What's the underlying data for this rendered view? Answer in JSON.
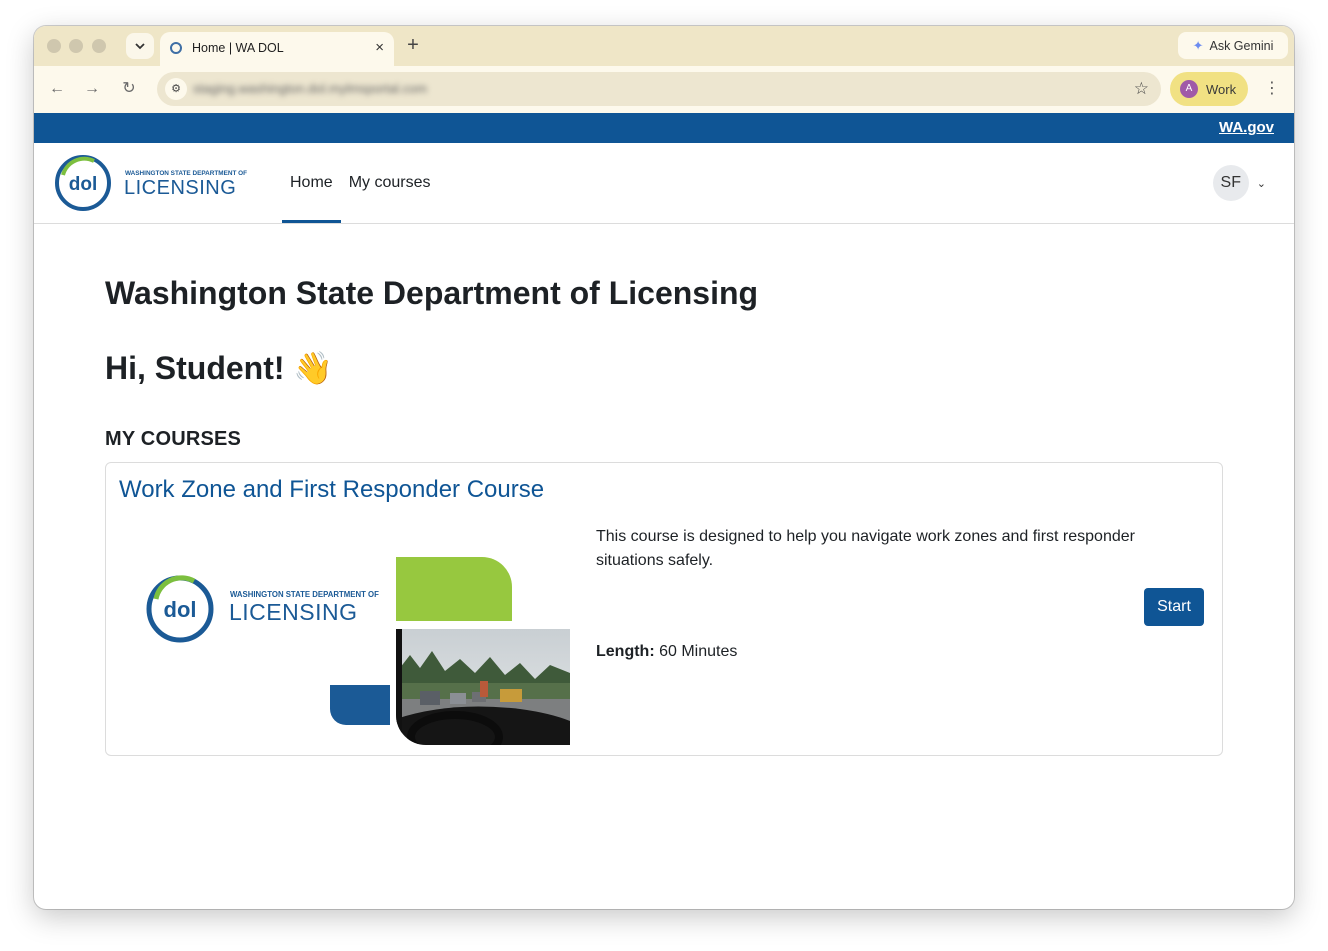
{
  "browser": {
    "tab_title": "Home | WA DOL",
    "new_tab_symbol": "+",
    "close_symbol": "×",
    "ask_gemini_label": "Ask Gemini",
    "url": "staging.washington.dol.mylmsportal.com",
    "profile_initial": "A",
    "profile_label": "Work"
  },
  "topbar": {
    "wagov_link": "WA.gov",
    "color": "#0f5595"
  },
  "logo": {
    "line1": "WASHINGTON STATE DEPARTMENT OF",
    "line2": "LICENSING",
    "monogram": "dol"
  },
  "nav": {
    "items": [
      {
        "label": "Home",
        "active": true
      },
      {
        "label": "My courses",
        "active": false
      }
    ],
    "user_initials": "SF",
    "user_caret": "⌄"
  },
  "main": {
    "page_title": "Washington State Department of Licensing",
    "greeting": "Hi, Student! 👋",
    "section_title": "MY COURSES"
  },
  "course": {
    "title": "Work Zone and First Responder Course",
    "description": "This course is designed to help you navigate work zones and first responder situations safely.",
    "length_label": "Length:",
    "length_value": "60 Minutes",
    "start_label": "Start",
    "image_logo_line1": "WASHINGTON STATE DEPARTMENT OF",
    "image_logo_line2": "LICENSING"
  },
  "colors": {
    "brand_blue": "#0f5595",
    "accent_green": "#97c83f",
    "tab_strip": "#efe6c7"
  }
}
